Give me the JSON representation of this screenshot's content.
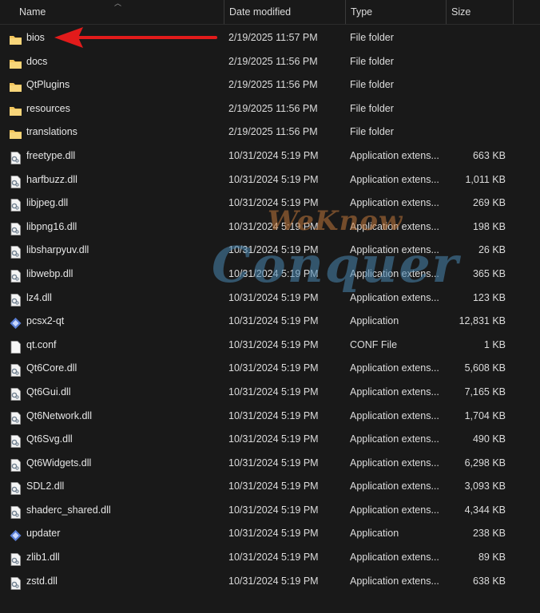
{
  "columns": {
    "name": "Name",
    "date": "Date modified",
    "type": "Type",
    "size": "Size"
  },
  "files": [
    {
      "name": "bios",
      "date": "2/19/2025 11:57 PM",
      "type": "File folder",
      "size": "",
      "icon": "folder-icon"
    },
    {
      "name": "docs",
      "date": "2/19/2025 11:56 PM",
      "type": "File folder",
      "size": "",
      "icon": "folder-icon"
    },
    {
      "name": "QtPlugins",
      "date": "2/19/2025 11:56 PM",
      "type": "File folder",
      "size": "",
      "icon": "folder-icon"
    },
    {
      "name": "resources",
      "date": "2/19/2025 11:56 PM",
      "type": "File folder",
      "size": "",
      "icon": "folder-icon"
    },
    {
      "name": "translations",
      "date": "2/19/2025 11:56 PM",
      "type": "File folder",
      "size": "",
      "icon": "folder-icon"
    },
    {
      "name": "freetype.dll",
      "date": "10/31/2024 5:19 PM",
      "type": "Application extens...",
      "size": "663 KB",
      "icon": "dll-file-icon"
    },
    {
      "name": "harfbuzz.dll",
      "date": "10/31/2024 5:19 PM",
      "type": "Application extens...",
      "size": "1,011 KB",
      "icon": "dll-file-icon"
    },
    {
      "name": "libjpeg.dll",
      "date": "10/31/2024 5:19 PM",
      "type": "Application extens...",
      "size": "269 KB",
      "icon": "dll-file-icon"
    },
    {
      "name": "libpng16.dll",
      "date": "10/31/2024 5:19 PM",
      "type": "Application extens...",
      "size": "198 KB",
      "icon": "dll-file-icon"
    },
    {
      "name": "libsharpyuv.dll",
      "date": "10/31/2024 5:19 PM",
      "type": "Application extens...",
      "size": "26 KB",
      "icon": "dll-file-icon"
    },
    {
      "name": "libwebp.dll",
      "date": "10/31/2024 5:19 PM",
      "type": "Application extens...",
      "size": "365 KB",
      "icon": "dll-file-icon"
    },
    {
      "name": "lz4.dll",
      "date": "10/31/2024 5:19 PM",
      "type": "Application extens...",
      "size": "123 KB",
      "icon": "dll-file-icon"
    },
    {
      "name": "pcsx2-qt",
      "date": "10/31/2024 5:19 PM",
      "type": "Application",
      "size": "12,831 KB",
      "icon": "application-icon"
    },
    {
      "name": "qt.conf",
      "date": "10/31/2024 5:19 PM",
      "type": "CONF File",
      "size": "1 KB",
      "icon": "blank-file-icon"
    },
    {
      "name": "Qt6Core.dll",
      "date": "10/31/2024 5:19 PM",
      "type": "Application extens...",
      "size": "5,608 KB",
      "icon": "dll-file-icon"
    },
    {
      "name": "Qt6Gui.dll",
      "date": "10/31/2024 5:19 PM",
      "type": "Application extens...",
      "size": "7,165 KB",
      "icon": "dll-file-icon"
    },
    {
      "name": "Qt6Network.dll",
      "date": "10/31/2024 5:19 PM",
      "type": "Application extens...",
      "size": "1,704 KB",
      "icon": "dll-file-icon"
    },
    {
      "name": "Qt6Svg.dll",
      "date": "10/31/2024 5:19 PM",
      "type": "Application extens...",
      "size": "490 KB",
      "icon": "dll-file-icon"
    },
    {
      "name": "Qt6Widgets.dll",
      "date": "10/31/2024 5:19 PM",
      "type": "Application extens...",
      "size": "6,298 KB",
      "icon": "dll-file-icon"
    },
    {
      "name": "SDL2.dll",
      "date": "10/31/2024 5:19 PM",
      "type": "Application extens...",
      "size": "3,093 KB",
      "icon": "dll-file-icon"
    },
    {
      "name": "shaderc_shared.dll",
      "date": "10/31/2024 5:19 PM",
      "type": "Application extens...",
      "size": "4,344 KB",
      "icon": "dll-file-icon"
    },
    {
      "name": "updater",
      "date": "10/31/2024 5:19 PM",
      "type": "Application",
      "size": "238 KB",
      "icon": "application-icon"
    },
    {
      "name": "zlib1.dll",
      "date": "10/31/2024 5:19 PM",
      "type": "Application extens...",
      "size": "89 KB",
      "icon": "dll-file-icon"
    },
    {
      "name": "zstd.dll",
      "date": "10/31/2024 5:19 PM",
      "type": "Application extens...",
      "size": "638 KB",
      "icon": "dll-file-icon"
    }
  ],
  "annotation": {
    "arrow_color": "#e21b1b",
    "arrow_points_to": "bios"
  },
  "watermark": {
    "line1": "WeKnow",
    "line2": "Conquer"
  },
  "colors": {
    "background": "#191919",
    "text": "#e6e6e6",
    "folder": "#f2c55c",
    "app_icon": "#5a7fd6"
  }
}
